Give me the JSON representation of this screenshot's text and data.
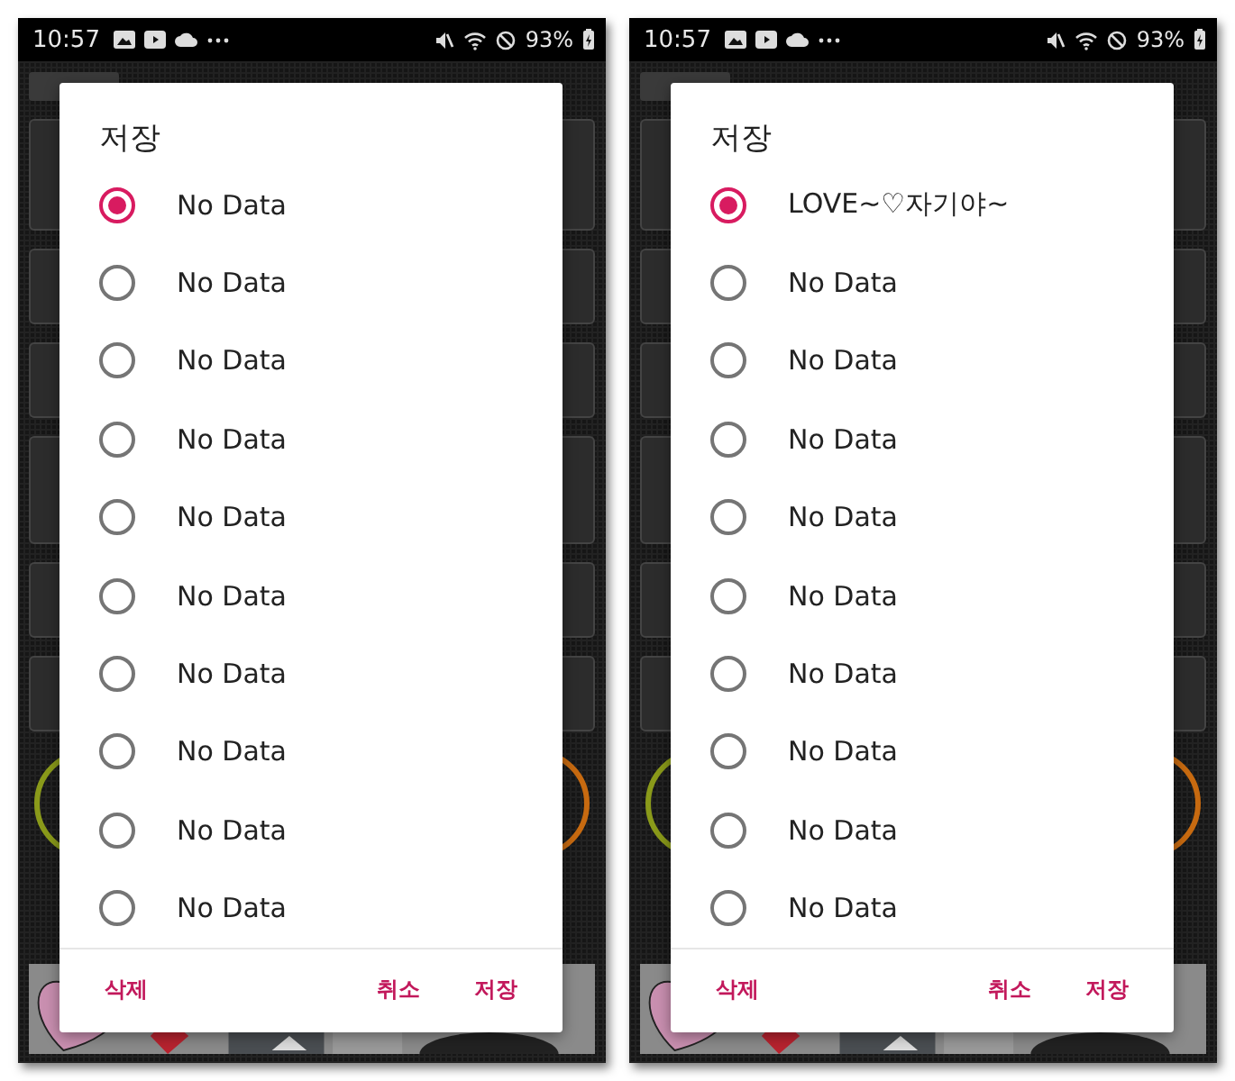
{
  "phones": [
    {
      "status_bar": {
        "time": "10:57",
        "battery": "93%"
      },
      "dialog": {
        "title": "저장",
        "options": [
          {
            "label": "No Data",
            "selected": true
          },
          {
            "label": "No Data",
            "selected": false
          },
          {
            "label": "No Data",
            "selected": false
          },
          {
            "label": "No Data",
            "selected": false
          },
          {
            "label": "No Data",
            "selected": false
          },
          {
            "label": "No Data",
            "selected": false
          },
          {
            "label": "No Data",
            "selected": false
          },
          {
            "label": "No Data",
            "selected": false
          },
          {
            "label": "No Data",
            "selected": false
          },
          {
            "label": "No Data",
            "selected": false
          }
        ],
        "buttons": {
          "left": [
            "삭제"
          ],
          "right": [
            "취소",
            "저장"
          ]
        }
      }
    },
    {
      "status_bar": {
        "time": "10:57",
        "battery": "93%"
      },
      "dialog": {
        "title": "저장",
        "options": [
          {
            "label": "LOVE~♡자기야~",
            "selected": true
          },
          {
            "label": "No Data",
            "selected": false
          },
          {
            "label": "No Data",
            "selected": false
          },
          {
            "label": "No Data",
            "selected": false
          },
          {
            "label": "No Data",
            "selected": false
          },
          {
            "label": "No Data",
            "selected": false
          },
          {
            "label": "No Data",
            "selected": false
          },
          {
            "label": "No Data",
            "selected": false
          },
          {
            "label": "No Data",
            "selected": false
          },
          {
            "label": "No Data",
            "selected": false
          }
        ],
        "buttons": {
          "left": [
            "삭제"
          ],
          "right": [
            "취소",
            "저장"
          ]
        }
      }
    }
  ]
}
